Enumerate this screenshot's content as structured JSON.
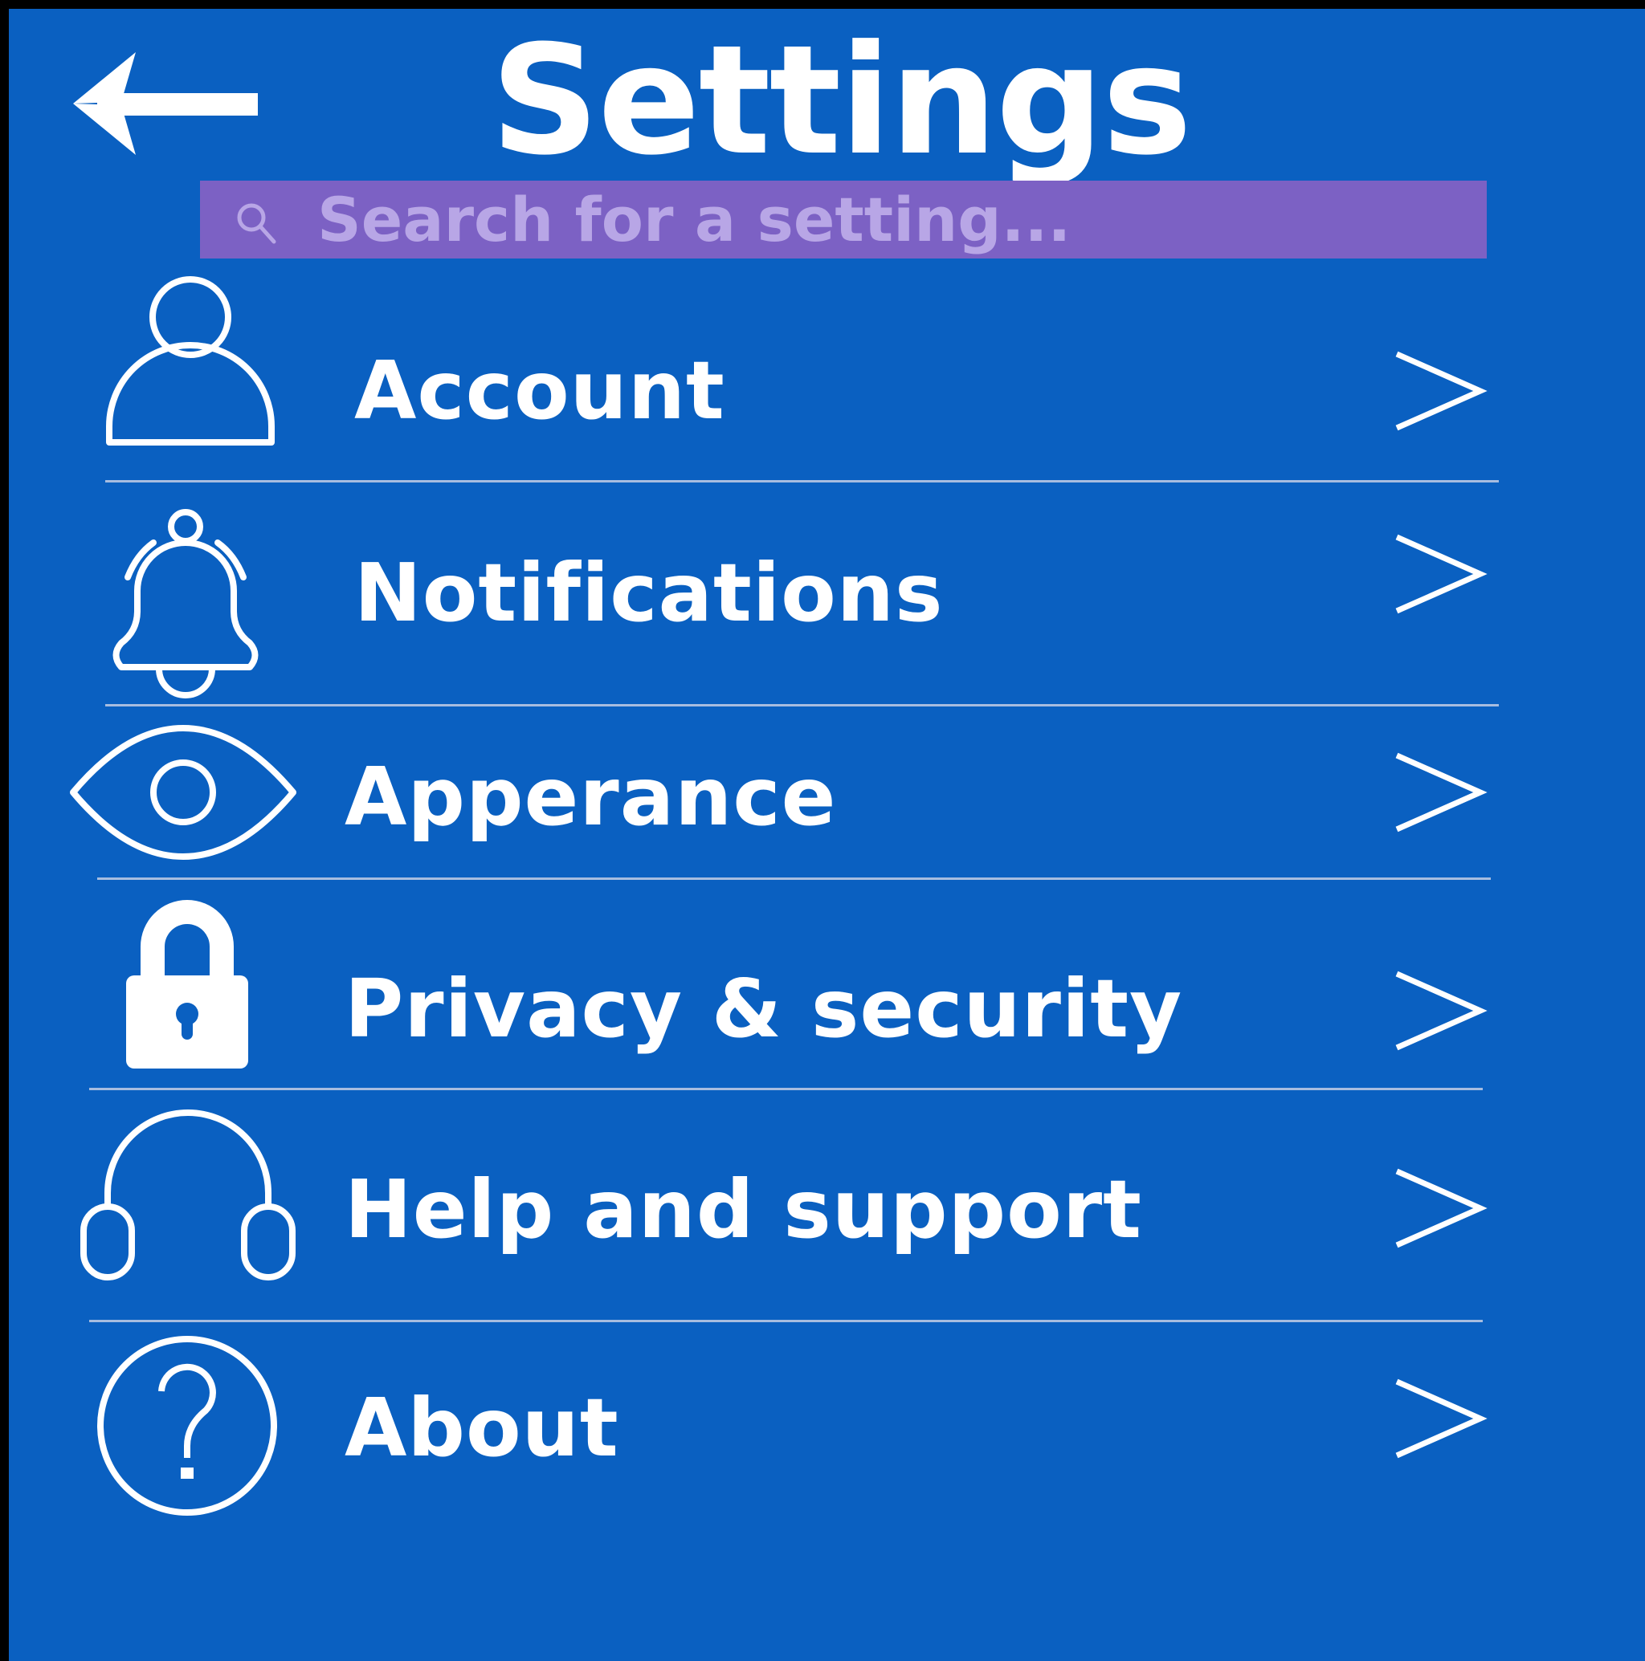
{
  "header": {
    "title": "Settings"
  },
  "search": {
    "placeholder": "Search for a setting..."
  },
  "menu": {
    "items": [
      {
        "label": "Account",
        "icon": "person-icon"
      },
      {
        "label": "Notifications",
        "icon": "bell-icon"
      },
      {
        "label": "Apperance",
        "icon": "eye-icon"
      },
      {
        "label": "Privacy & security",
        "icon": "lock-icon"
      },
      {
        "label": "Help and support",
        "icon": "headphones-icon"
      },
      {
        "label": "About",
        "icon": "help-circle-icon"
      }
    ],
    "chevron": ">"
  },
  "colors": {
    "background": "#0a60c1",
    "frame": "#000000",
    "search_bar": "#7c61c4",
    "search_text": "#b8a6e6",
    "text": "#ffffff",
    "divider": "#a7bde0"
  }
}
